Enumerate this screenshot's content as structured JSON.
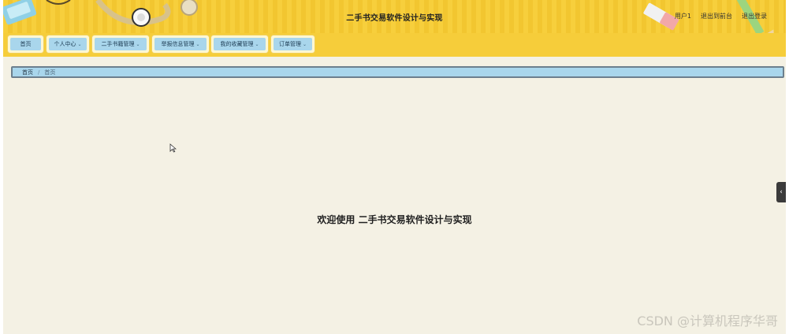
{
  "header": {
    "title": "二手书交易软件设计与实现",
    "user_label": "用户1",
    "back_to_front": "退出到前台",
    "logout": "退出登录"
  },
  "nav": {
    "items": [
      {
        "label": "首页",
        "has_dropdown": false
      },
      {
        "label": "个人中心",
        "has_dropdown": true
      },
      {
        "label": "二手书籍管理",
        "has_dropdown": true
      },
      {
        "label": "举报信息管理",
        "has_dropdown": true
      },
      {
        "label": "我的收藏管理",
        "has_dropdown": true
      },
      {
        "label": "订单管理",
        "has_dropdown": true
      }
    ],
    "chevron": "⌄"
  },
  "breadcrumb": {
    "root": "首页",
    "separator": "/",
    "current": "首页"
  },
  "main": {
    "welcome": "欢迎使用 二手书交易软件设计与实现"
  },
  "side_toggle": {
    "glyph": "‹"
  },
  "watermark": "CSDN @计算机程序华哥",
  "colors": {
    "header_bg": "#f7cf3c",
    "nav_item_bg": "#a9d6ec",
    "page_bg": "#f4f1e4"
  }
}
